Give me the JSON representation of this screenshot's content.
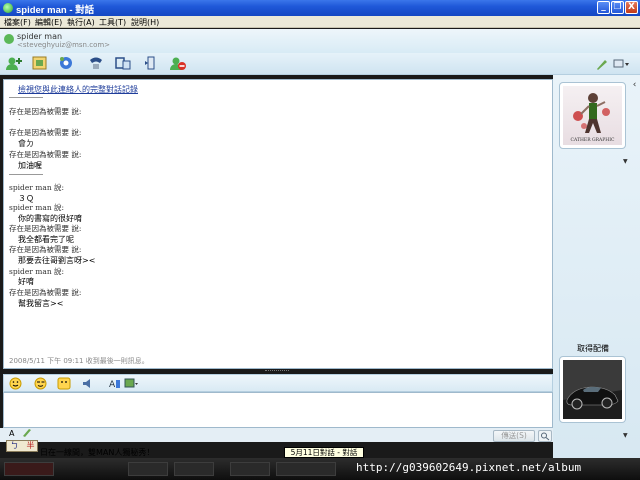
{
  "window": {
    "title": "spider man - 對話",
    "controls": [
      "_",
      "❐",
      "X"
    ]
  },
  "menu": [
    "檔案(F)",
    "編輯(E)",
    "執行(A)",
    "工具(T)",
    "說明(H)"
  ],
  "contact": {
    "name": "spider man",
    "email": "<steveghyuiz@msn.com>"
  },
  "toolbar": {
    "buttons": [
      "invite",
      "send-files",
      "webcam",
      "call",
      "activities",
      "games",
      "block"
    ]
  },
  "conversation": {
    "header_link": "檢視您與此連絡人的完整對話記錄",
    "entries": [
      {
        "sender": "存在是因為被需要 說:",
        "message": "."
      },
      {
        "sender": "存在是因為被需要 說:",
        "message": "會ㄉ"
      },
      {
        "sender": "存在是因為被需要 說:",
        "message": "加油喔"
      },
      {
        "sender": "spider man 說:",
        "message": "３Ｑ"
      },
      {
        "sender": "spider man 說:",
        "message": "你的書寫的很好唷"
      },
      {
        "sender": "存在是因為被需要 說:",
        "message": "我全都看完了呢"
      },
      {
        "sender": "存在是因為被需要 說:",
        "message": "那要去往哥劉言呀><"
      },
      {
        "sender": "spider man 說:",
        "message": "好唷"
      },
      {
        "sender": "存在是因為被需要 說:",
        "message": "幫我留言><"
      }
    ],
    "status": "2008/5/11 下午 09:11 收到最後一則訊息。"
  },
  "side_panel": {
    "contact_photo_caption": "CATHER GRAPHIC",
    "my_photo_label": "取得配備"
  },
  "compose": {
    "send_label": "傳送(S)",
    "format_a": "A",
    "ime_left": "ㄅ",
    "ime_right": "半"
  },
  "footer": {
    "status_text": "日在一線間，雙MAN人獨秘秀！",
    "tooltip": "5月11日對話 - 對話",
    "watermark": "http://g039602649.pixnet.net/album"
  },
  "colors": {
    "titlebar": "#1f58d8",
    "link": "#1f3d9b",
    "panel": "#d7e8f2"
  }
}
